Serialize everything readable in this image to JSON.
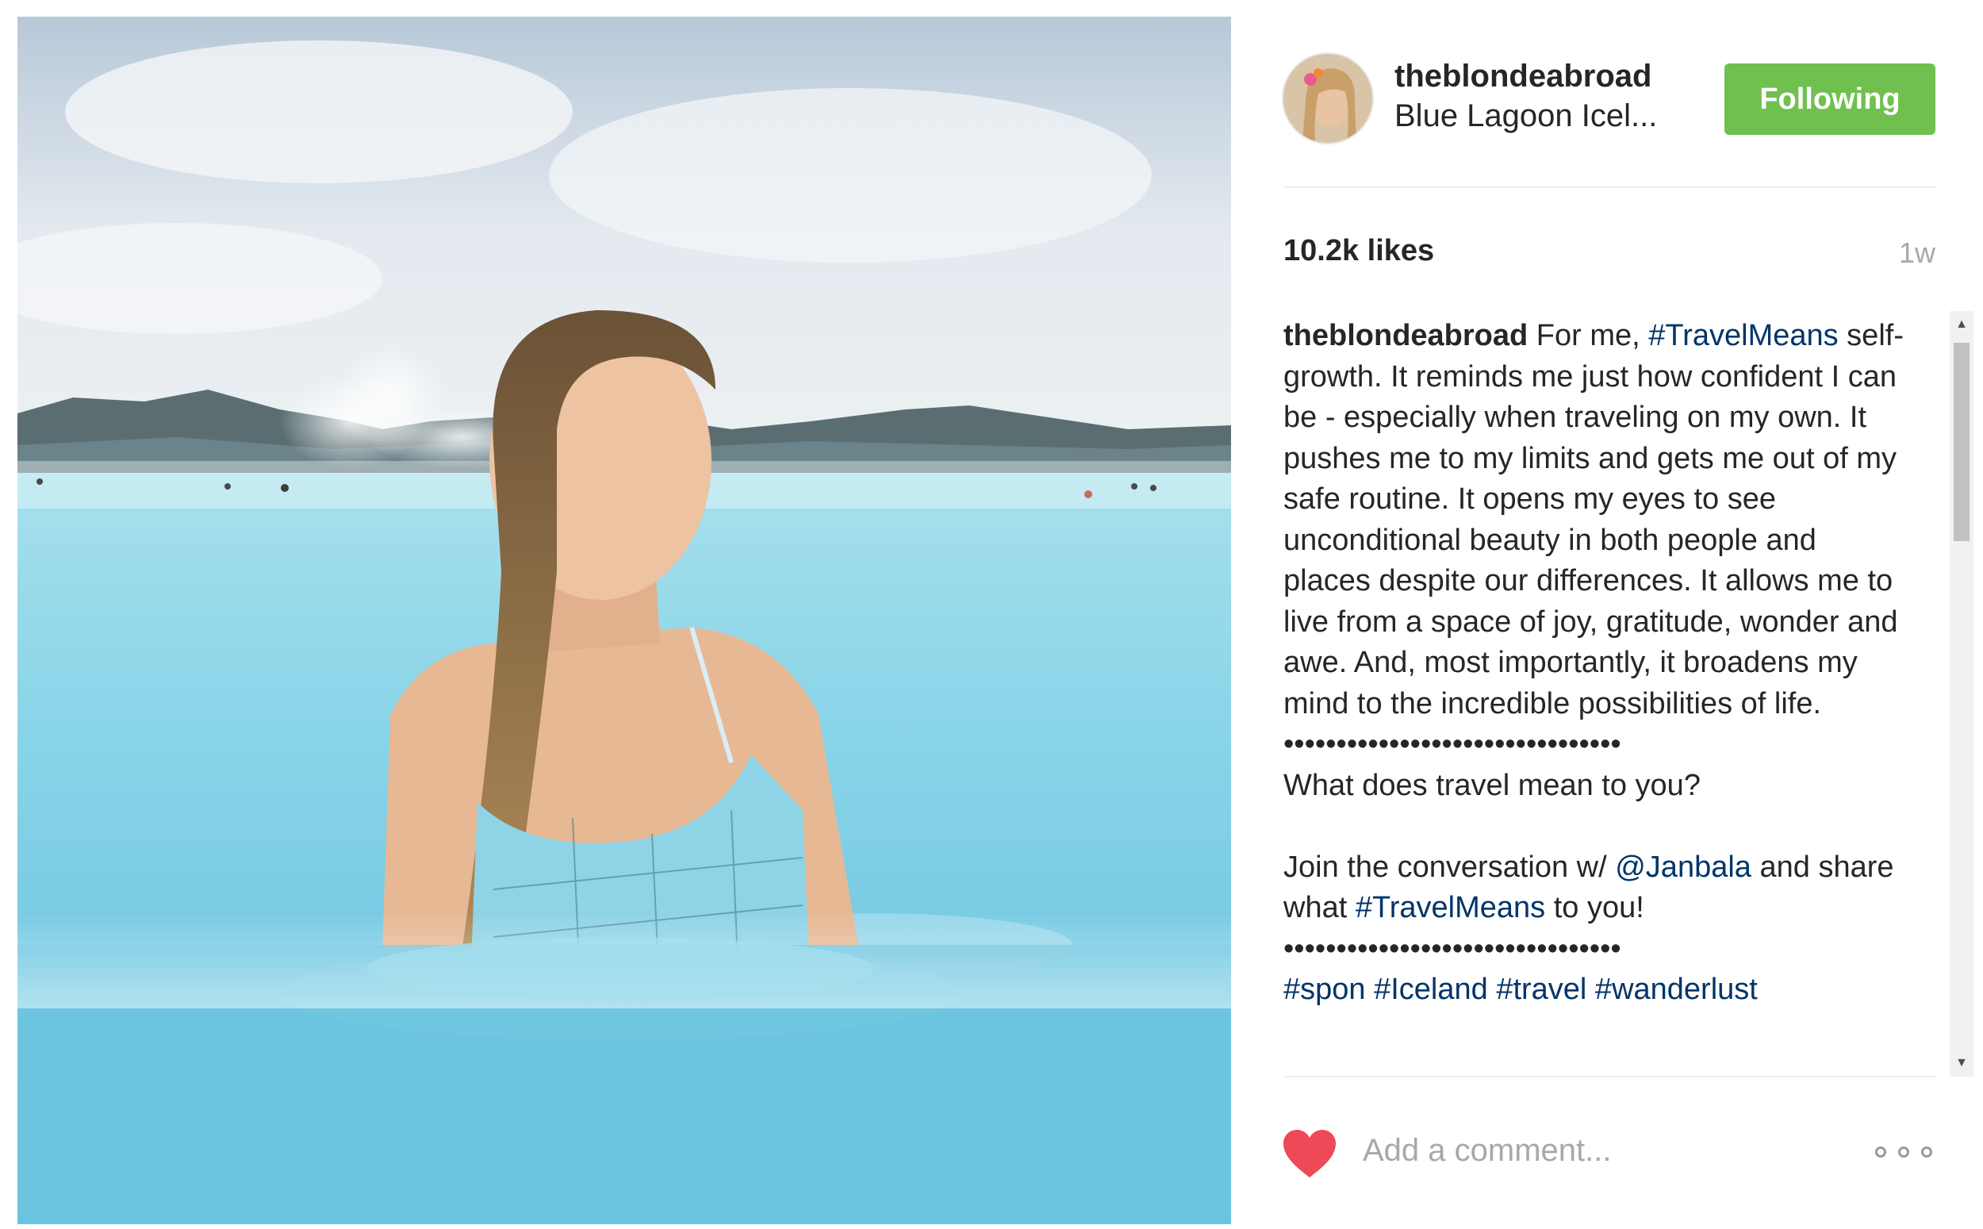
{
  "post": {
    "username": "theblondeabroad",
    "location": "Blue Lagoon Icel...",
    "follow_label": "Following",
    "likes": "10.2k likes",
    "age": "1w"
  },
  "caption": {
    "user": "theblondeabroad",
    "p1": " For me, ",
    "tag_travelmeans": "#TravelMeans",
    "p2": " self-growth. It reminds me just how confident I can be - especially when traveling on my own. It pushes me to my limits and gets me out of my safe routine. It opens my eyes to see unconditional beauty in both people and places despite our differences. It allows me to live from a space of joy, gratitude, wonder and awe. And, most importantly, it broadens my mind to the incredible possibilities of life.",
    "dots": "••••••••••••••••••••••••••••••••",
    "question": "What does travel mean to you?",
    "join_pre": "Join the conversation w/ ",
    "mention": "@Janbala",
    "join_mid": " and share what ",
    "tag_travelmeans_2": "#TravelMeans",
    "join_post": " to you!",
    "dots_2": "••••••••••••••••••••••••••••••••",
    "hashtags": "#spon #Iceland #travel #wanderlust"
  },
  "comment": {
    "placeholder": "Add a comment..."
  },
  "icons": {
    "heart": "heart-icon",
    "more": "more-options-icon",
    "scroll_up": "scroll-up-arrow-icon",
    "scroll_down": "scroll-down-arrow-icon"
  },
  "colors": {
    "follow_button": "#70c050",
    "link": "#003569",
    "heart": "#ed4956",
    "lagoon": "#7fd0e6"
  }
}
